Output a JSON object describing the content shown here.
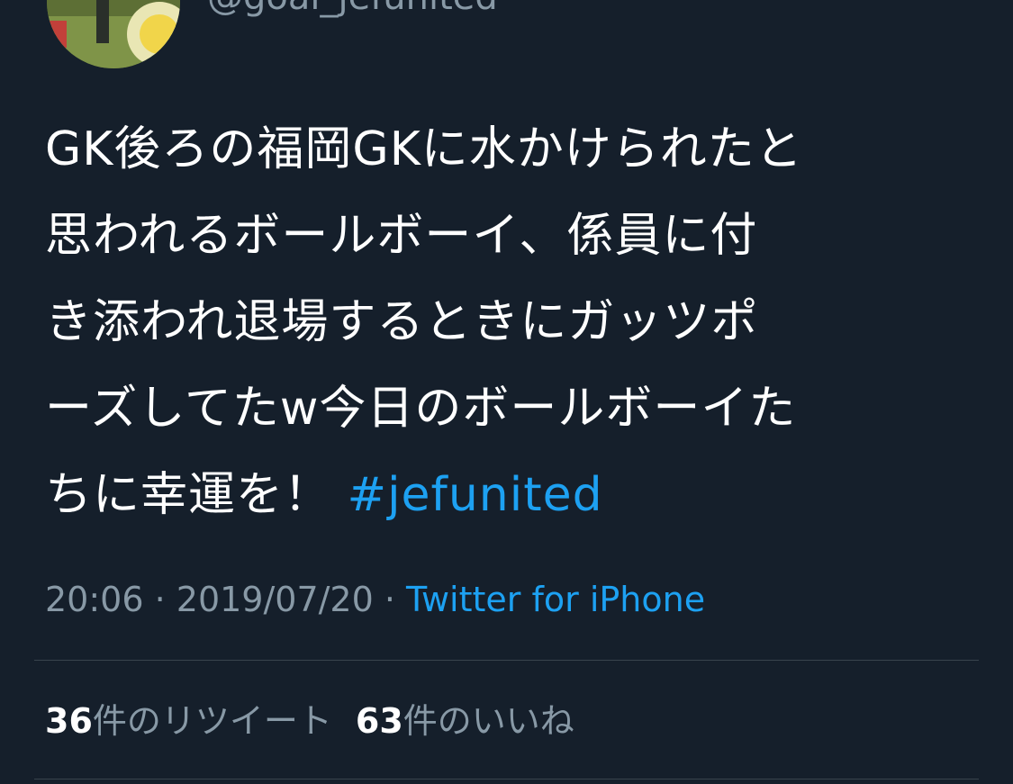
{
  "tweet": {
    "handle": "@goal_jefunited",
    "text_lines": [
      "GK後ろの福岡GKに水かけられたと",
      "思われるボールボーイ、係員に付",
      "き添われ退場するときにガッツポ",
      "ーズしてたw今日のボールボーイた",
      "ちに幸運を！ "
    ],
    "hashtag": "#jefunited",
    "time": "20:06",
    "separator": " · ",
    "date": "2019/07/20",
    "source": "Twitter for iPhone"
  },
  "stats": {
    "retweet_count": "36",
    "retweet_label": "件のリツイート",
    "like_count": "63",
    "like_label": "件のいいね"
  },
  "colors": {
    "background": "#151f2b",
    "text": "#ffffff",
    "secondary": "#8899a6",
    "link": "#1da1f2",
    "divider": "#38444d"
  }
}
